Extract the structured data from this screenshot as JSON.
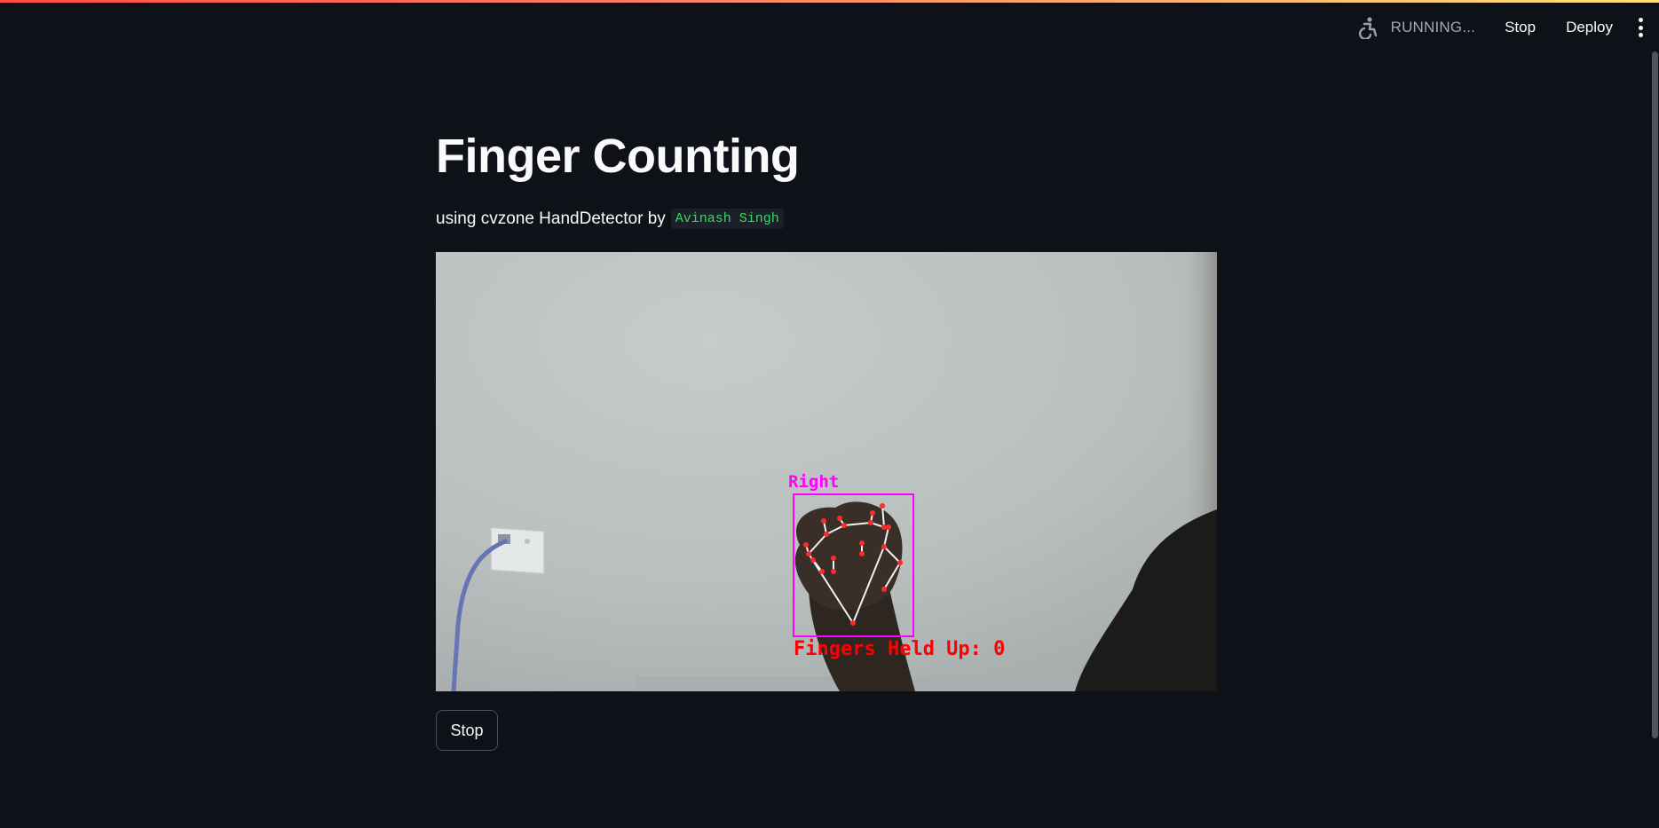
{
  "toolbar": {
    "status": "RUNNING...",
    "stop_label": "Stop",
    "deploy_label": "Deploy"
  },
  "page": {
    "title": "Finger Counting",
    "subtitle_prefix": "using cvzone HandDetector by",
    "author": "Avinash Singh"
  },
  "video": {
    "hand_label": "Right",
    "count_text": "Fingers Held Up: 0"
  },
  "controls": {
    "stop_label": "Stop"
  },
  "colors": {
    "background": "#0e1117",
    "author_code": "#3dd56d",
    "bbox": "#ff00ff",
    "count_text": "#ff0000"
  }
}
